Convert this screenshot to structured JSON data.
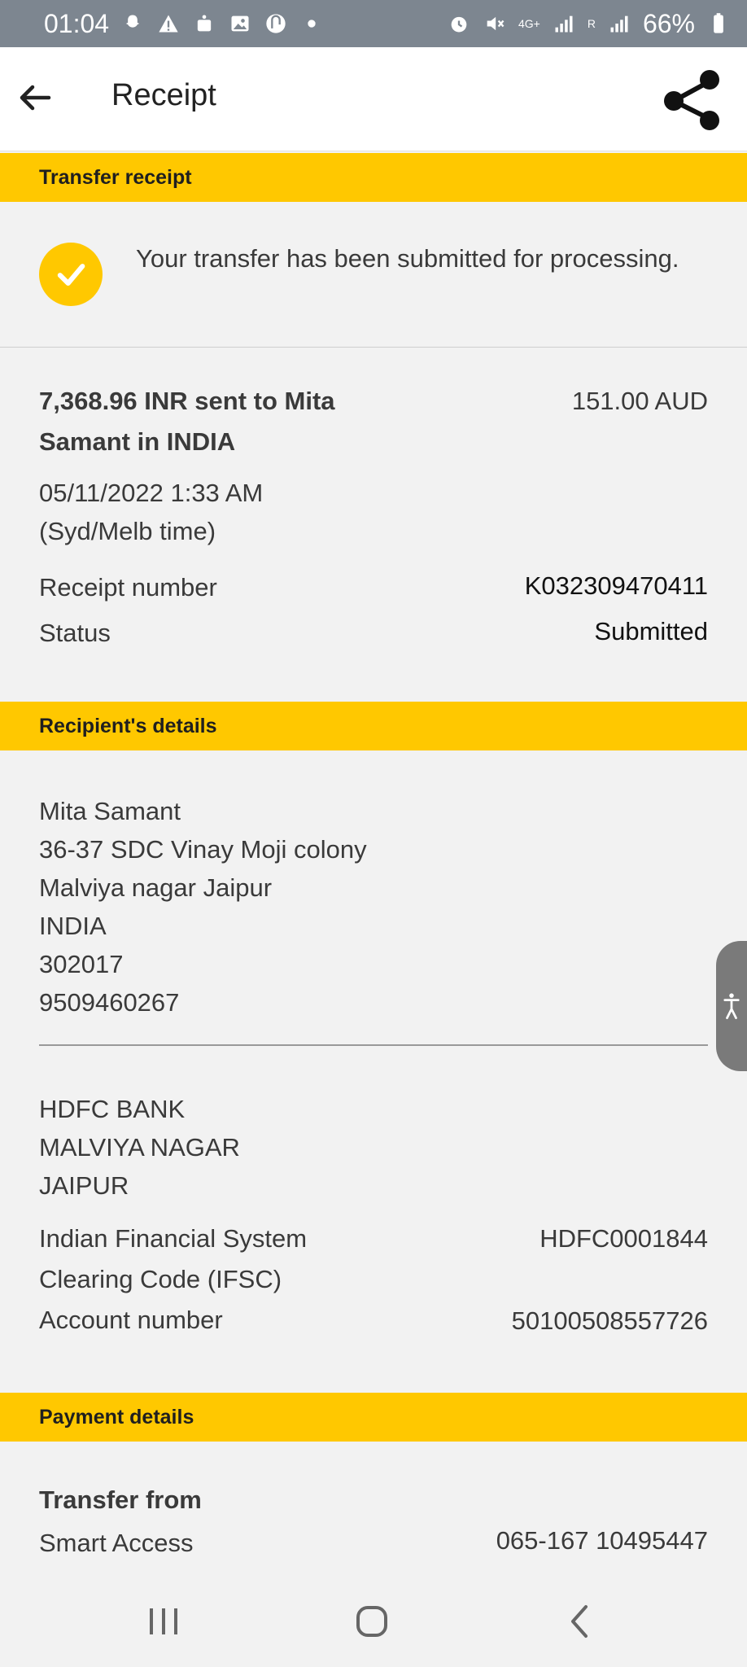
{
  "status_bar": {
    "time": "01:04",
    "battery": "66%",
    "network": "4G+",
    "sim_label": "R",
    "icons": [
      "snapchat-icon",
      "warning-icon",
      "calendar-badge-icon",
      "gallery-icon",
      "app-icon",
      "dot-icon",
      "alarm-icon",
      "mute-icon",
      "signal-icon",
      "battery-icon"
    ]
  },
  "appbar": {
    "title": "Receipt"
  },
  "sections": {
    "transfer_receipt": "Transfer receipt",
    "recipients_details": "Recipient's details",
    "payment_details": "Payment details"
  },
  "confirmation": {
    "message": "Your transfer has been submitted for processing."
  },
  "transfer": {
    "summary_line1": "7,368.96 INR sent to Mita",
    "summary_line2": "Samant in INDIA",
    "amount_aud": "151.00 AUD",
    "datetime": "05/11/2022 1:33 AM",
    "timezone": "(Syd/Melb time)",
    "receipt_label": "Receipt number",
    "receipt_value": "K032309470411",
    "status_label": "Status",
    "status_value": "Submitted"
  },
  "recipient": {
    "address_lines": [
      "Mita Samant",
      "36-37 SDC Vinay Moji colony",
      "Malviya nagar Jaipur",
      "INDIA",
      "302017",
      "9509460267"
    ],
    "bank_lines": [
      "HDFC BANK",
      "MALVIYA NAGAR",
      "JAIPUR"
    ],
    "ifsc_label_1": "Indian Financial System",
    "ifsc_label_2": "Clearing Code (IFSC)",
    "ifsc_value": "HDFC0001844",
    "account_label": "Account number",
    "account_value": "50100508557726"
  },
  "payment": {
    "transfer_from_label": "Transfer from",
    "account_name": "Smart Access",
    "account_number": "065-167 10495447"
  },
  "colors": {
    "accent": "#ffc800",
    "status_bar": "#7d8690",
    "background": "#f2f2f2"
  }
}
